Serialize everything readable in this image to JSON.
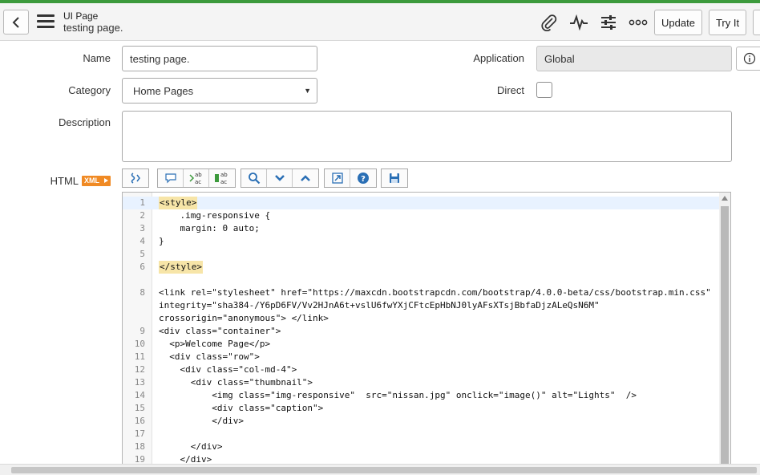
{
  "header": {
    "record_type": "UI Page",
    "record_name": "testing page.",
    "icons": [
      "back-icon",
      "menu-icon",
      "paperclip-icon",
      "activity-icon",
      "settings-sliders-icon",
      "more-icon"
    ],
    "buttons": {
      "update": "Update",
      "try_it": "Try It"
    }
  },
  "form": {
    "name": {
      "label": "Name",
      "value": "testing page."
    },
    "application": {
      "label": "Application",
      "value": "Global"
    },
    "category": {
      "label": "Category",
      "value": "Home Pages"
    },
    "direct": {
      "label": "Direct",
      "checked": false
    },
    "description": {
      "label": "Description",
      "value": ""
    },
    "html": {
      "label": "HTML",
      "badge": "XML"
    }
  },
  "editor": {
    "toolbar": [
      "format-code-icon",
      "comment-icon",
      "replace-icon",
      "replace-all-icon",
      "search-icon",
      "next-icon",
      "previous-icon",
      "fullscreen-icon",
      "help-icon",
      "save-icon"
    ],
    "lines": [
      {
        "n": "1",
        "text": "<style>",
        "tagged": true,
        "active": true
      },
      {
        "n": "2",
        "text": "    .img-responsive {"
      },
      {
        "n": "3",
        "text": "    margin: 0 auto;"
      },
      {
        "n": "4",
        "text": "}"
      },
      {
        "n": "5",
        "text": ""
      },
      {
        "n": "6",
        "text": "</style>",
        "tagged": true
      },
      {
        "n": "",
        "text": ""
      },
      {
        "n": "8",
        "text": "<link rel=\"stylesheet\" href=\"https://maxcdn.bootstrapcdn.com/bootstrap/4.0.0-beta/css/bootstrap.min.css\""
      },
      {
        "n": "",
        "text": "integrity=\"sha384-/Y6pD6FV/Vv2HJnA6t+vslU6fwYXjCFtcEpHbNJ0lyAFsXTsjBbfaDjzALeQsN6M\""
      },
      {
        "n": "",
        "text": "crossorigin=\"anonymous\"> </link>"
      },
      {
        "n": "9",
        "text": "<div class=\"container\">"
      },
      {
        "n": "10",
        "text": "  <p>Welcome Page</p>"
      },
      {
        "n": "11",
        "text": "  <div class=\"row\">"
      },
      {
        "n": "12",
        "text": "    <div class=\"col-md-4\">"
      },
      {
        "n": "13",
        "text": "      <div class=\"thumbnail\">"
      },
      {
        "n": "14",
        "text": "          <img class=\"img-responsive\"  src=\"nissan.jpg\" onclick=\"image()\" alt=\"Lights\"  />"
      },
      {
        "n": "15",
        "text": "          <div class=\"caption\">"
      },
      {
        "n": "16",
        "text": "          </div>"
      },
      {
        "n": "17",
        "text": ""
      },
      {
        "n": "18",
        "text": "      </div>"
      },
      {
        "n": "19",
        "text": "    </div>"
      }
    ]
  }
}
